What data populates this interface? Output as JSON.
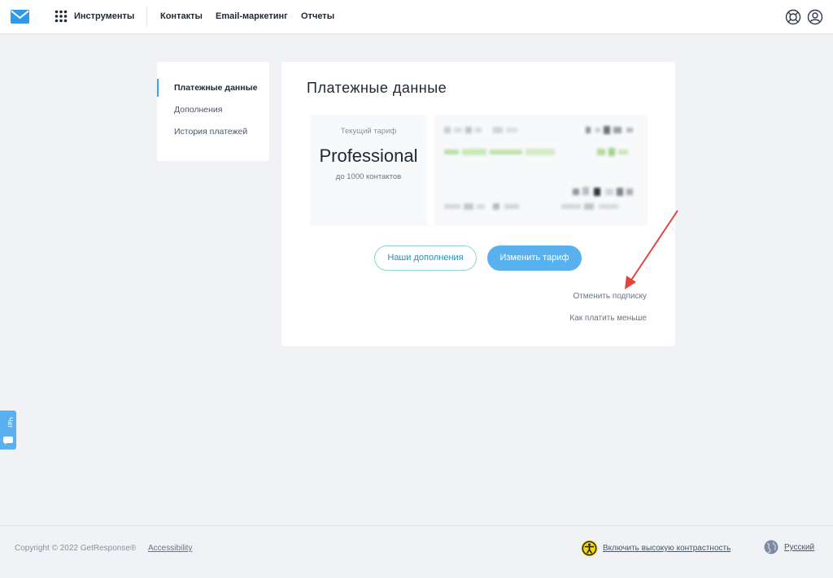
{
  "colors": {
    "accent": "#59b2ef",
    "background": "#f1f2f6",
    "arrow": "#e0443c",
    "active_indicator": "#3aa3ef"
  },
  "nav": {
    "logo_icon": "envelope-icon",
    "apps_icon": "grid-dots-icon",
    "tools_label": "Инструменты",
    "links": [
      "Контакты",
      "Email-маркетинг",
      "Отчеты"
    ],
    "help_icon": "lifebuoy-icon",
    "user_icon": "user-circle-icon"
  },
  "sidebar": {
    "items": [
      {
        "label": "Платежные данные",
        "active": true
      },
      {
        "label": "Дополнения",
        "active": false
      },
      {
        "label": "История платежей",
        "active": false
      }
    ]
  },
  "main": {
    "title": "Платежные данные",
    "plan": {
      "label": "Текущий тариф",
      "name": "Professional",
      "limit": "до 1000 контактов"
    },
    "buttons": {
      "addons": "Наши дополнения",
      "change_plan": "Изменить тариф"
    },
    "links": {
      "cancel": "Отменить подписку",
      "pay_less": "Как платить меньше"
    }
  },
  "chat": {
    "label": "Чат",
    "icon": "chat-bubble-icon"
  },
  "footer": {
    "copyright": "Copyright © 2022 GetResponse®",
    "accessibility": "Accessibility",
    "contrast_icon": "accessibility-person-icon",
    "contrast": "Включить высокую контрастность",
    "globe_icon": "globe-icon",
    "language": "Русский"
  }
}
